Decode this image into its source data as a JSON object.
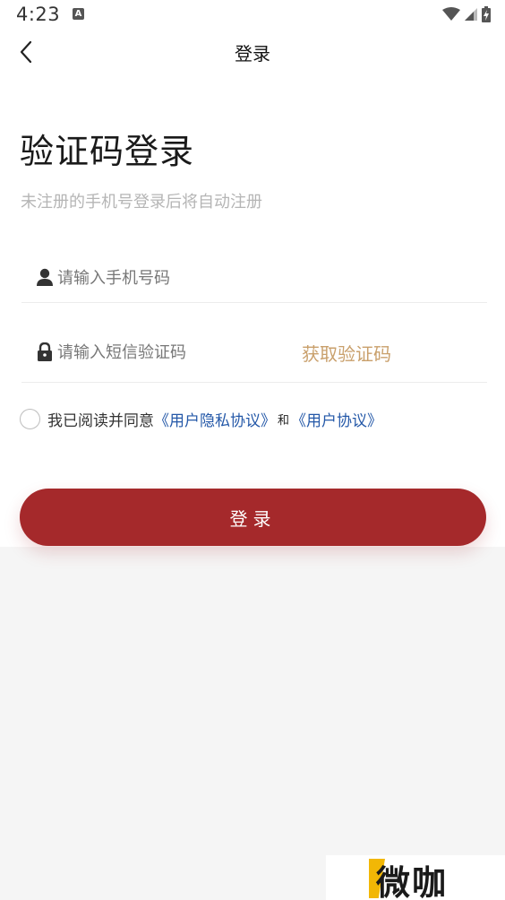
{
  "status_bar": {
    "time": "4:23",
    "a_badge": "A",
    "icons": [
      "wifi-icon",
      "signal-icon",
      "battery-icon"
    ]
  },
  "nav": {
    "back_icon": "chevron-left-icon",
    "title": "登录"
  },
  "heading": "验证码登录",
  "subtitle": "未注册的手机号登录后将自动注册",
  "phone_field": {
    "icon": "person-icon",
    "placeholder": "请输入手机号码"
  },
  "code_field": {
    "icon": "lock-icon",
    "placeholder": "请输入短信验证码",
    "get_code_label": "获取验证码"
  },
  "agreement": {
    "prefix": "我已阅读并同意",
    "privacy_link": "《用户隐私协议》",
    "and": "和",
    "user_link": "《用户协议》"
  },
  "login_button": "登录",
  "watermark": "微咖",
  "colors": {
    "primary": "#a5292b",
    "accent": "#c9a06c",
    "link": "#2458a8",
    "background": "#f5f5f5"
  }
}
